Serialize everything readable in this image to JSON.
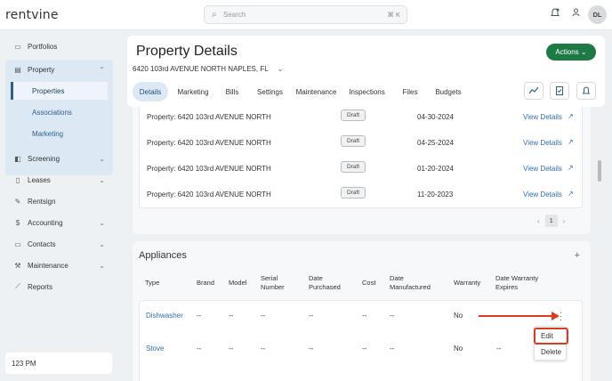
{
  "app": {
    "logo": "rentvine"
  },
  "search": {
    "placeholder": "Search",
    "shortcut": "⌘ K"
  },
  "user": {
    "initials": "DL"
  },
  "sidebar": {
    "items": [
      {
        "label": "Portfolios",
        "icon": "folder-icon"
      },
      {
        "label": "Property",
        "icon": "building-icon"
      },
      {
        "label": "Screening",
        "icon": "screening-icon"
      },
      {
        "label": "Leases",
        "icon": "document-icon"
      },
      {
        "label": "Rentsign",
        "icon": "signature-icon"
      },
      {
        "label": "Accounting",
        "icon": "dollar-icon"
      },
      {
        "label": "Contacts",
        "icon": "contacts-icon"
      },
      {
        "label": "Maintenance",
        "icon": "wrench-icon"
      },
      {
        "label": "Reports",
        "icon": "chart-icon"
      }
    ],
    "property_sub": [
      "Properties",
      "Associations",
      "Marketing"
    ],
    "time": "123 PM"
  },
  "header": {
    "title": "Property Details",
    "address": "6420 103rd AVENUE NORTH NAPLES, FL",
    "actions_label": "Actions",
    "tabs": [
      "Details",
      "Marketing",
      "Bills",
      "Settings",
      "Maintenance",
      "Inspections",
      "Files",
      "Budgets"
    ]
  },
  "property_list": {
    "rows": [
      {
        "property": "Property: 6420 103rd AVENUE NORTH",
        "status": "Draft",
        "date": "04-30-2024",
        "link": "View Details"
      },
      {
        "property": "Property: 6420 103rd AVENUE NORTH",
        "status": "Draft",
        "date": "04-25-2024",
        "link": "View Details"
      },
      {
        "property": "Property: 6420 103rd AVENUE NORTH",
        "status": "Draft",
        "date": "01-20-2024",
        "link": "View Details"
      },
      {
        "property": "Property: 6420 103rd AVENUE NORTH",
        "status": "Draft",
        "date": "11-20-2023",
        "link": "View Details"
      }
    ],
    "page": "1"
  },
  "appliances": {
    "title": "Appliances",
    "headers": [
      "Type",
      "Brand",
      "Model",
      "Serial\nNumber",
      "Date\nPurchased",
      "Cost",
      "Date\nManufactured",
      "Warranty",
      "Date Warranty\nExpires"
    ],
    "rows": [
      {
        "type": "Dishwasher",
        "brand": "--",
        "model": "--",
        "serial": "--",
        "purchased": "--",
        "cost": "--",
        "manufactured": "--",
        "warranty": "No",
        "expires": ""
      },
      {
        "type": "Stove",
        "brand": "--",
        "model": "--",
        "serial": "--",
        "purchased": "--",
        "cost": "--",
        "manufactured": "--",
        "warranty": "No",
        "expires": "--"
      }
    ]
  },
  "row_menu": {
    "edit": "Edit",
    "delete": "Delete"
  },
  "colors": {
    "accent_green": "#1e7a45",
    "link_blue": "#2f6fb0",
    "annotation_red": "#e03a1e",
    "nav_highlight": "#dce9f5"
  }
}
